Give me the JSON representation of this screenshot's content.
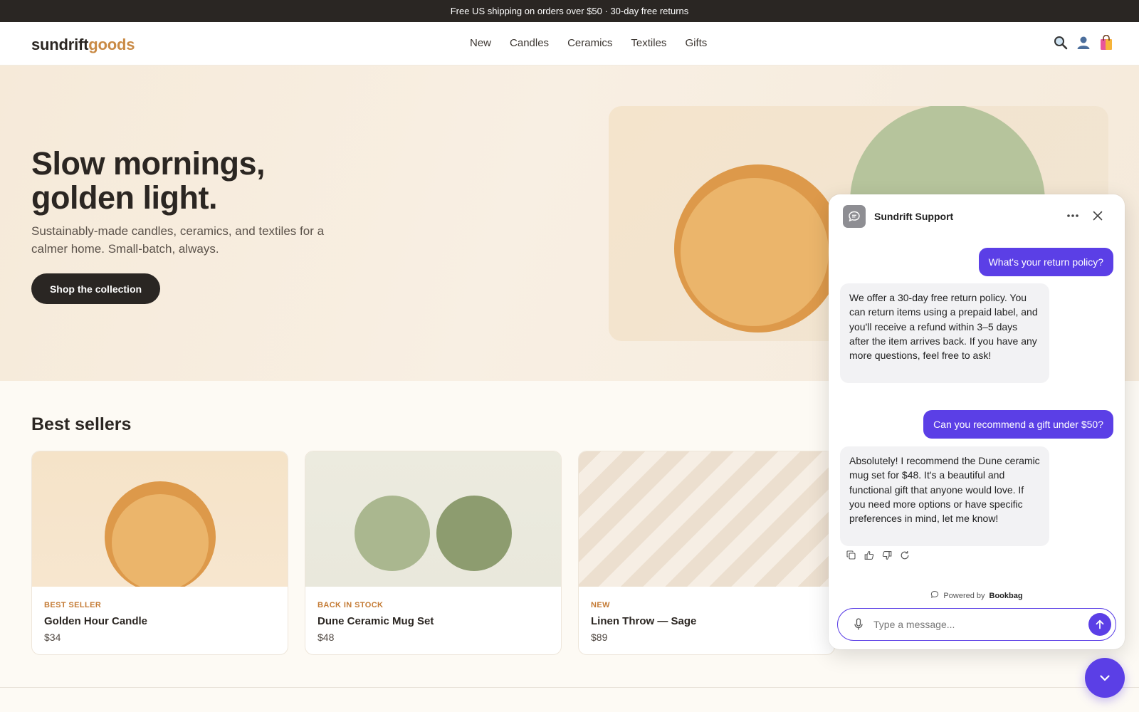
{
  "announcement": {
    "text": "Free US shipping on orders over $50 · 30-day free returns"
  },
  "header": {
    "logo_part1": "sundrift",
    "logo_part2": "goods",
    "nav": [
      "New",
      "Candles",
      "Ceramics",
      "Textiles",
      "Gifts"
    ],
    "icons": [
      "search-icon",
      "account-icon",
      "shopping-bag-icon"
    ]
  },
  "hero": {
    "title_line1": "Slow mornings,",
    "title_line2": "golden light.",
    "subtitle": "Sustainably-made candles, ceramics, and textiles for a calmer home. Small-batch, always.",
    "cta_label": "Shop the collection"
  },
  "best_sellers": {
    "title": "Best sellers",
    "products": [
      {
        "tag": "BEST SELLER",
        "name": "Golden Hour Candle",
        "price": "$34"
      },
      {
        "tag": "BACK IN STOCK",
        "name": "Dune Ceramic Mug Set",
        "price": "$48"
      },
      {
        "tag": "NEW",
        "name": "Linen Throw — Sage",
        "price": "$89"
      }
    ]
  },
  "chat": {
    "title": "Sundrift Support",
    "messages": [
      {
        "role": "user",
        "text": "What's your return policy?"
      },
      {
        "role": "bot",
        "text": "We offer a 30-day free return policy. You can return items using a prepaid label, and you'll receive a refund within 3–5 days after the item arrives back. If you have any more questions, feel free to ask!"
      },
      {
        "role": "user",
        "text": "Can you recommend a gift under $50?"
      },
      {
        "role": "bot",
        "text": "Absolutely! I recommend the Dune ceramic mug set for $48. It's a beautiful and functional gift that anyone would love. If you need more options or have specific preferences in mind, let me know!"
      }
    ],
    "powered_by_prefix": "Powered by",
    "powered_by_brand": "Bookbag",
    "input_placeholder": "Type a message...",
    "accent_color": "#5b3fe6"
  },
  "colors": {
    "brand_dark": "#2a2623",
    "brand_accent": "#c98a45",
    "tag_color": "#c47b35"
  }
}
